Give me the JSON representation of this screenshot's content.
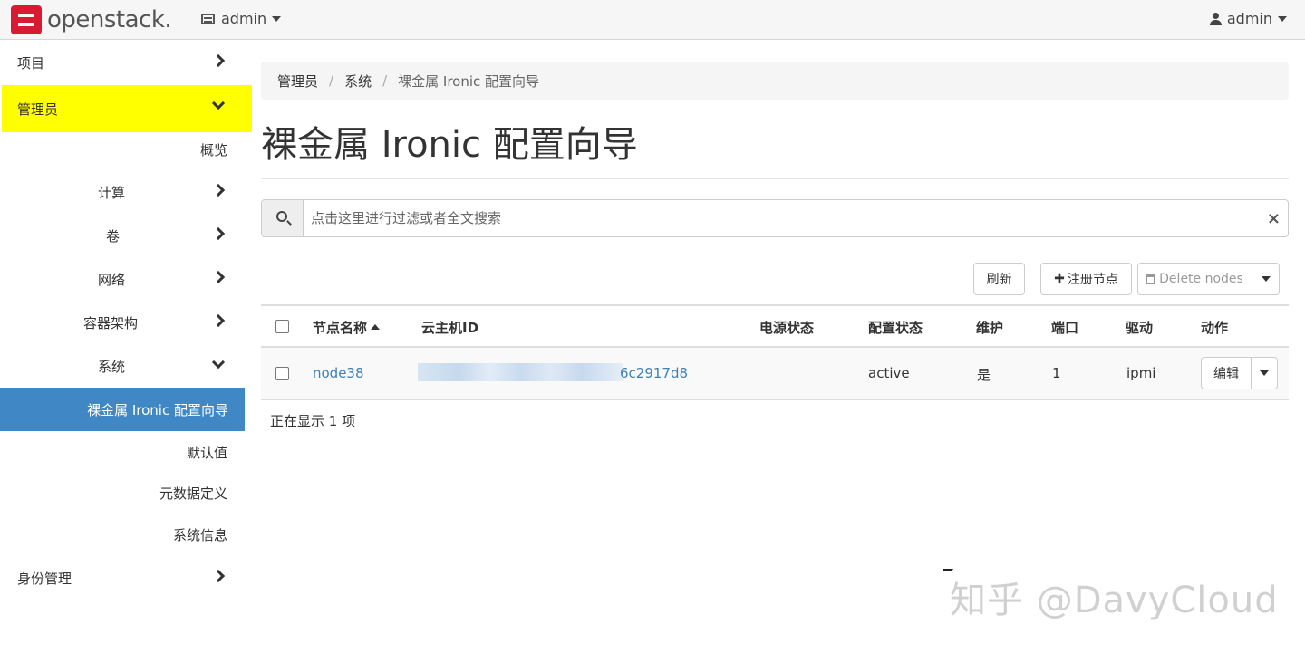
{
  "header": {
    "logo_text": "openstack.",
    "project": "admin",
    "user": "admin"
  },
  "sidebar": {
    "items": [
      {
        "label": "项目"
      },
      {
        "label": "管理员"
      },
      {
        "label": "概览"
      },
      {
        "label": "计算"
      },
      {
        "label": "卷"
      },
      {
        "label": "网络"
      },
      {
        "label": "容器架构"
      },
      {
        "label": "系统"
      },
      {
        "label": "裸金属 Ironic 配置向导"
      },
      {
        "label": "默认值"
      },
      {
        "label": "元数据定义"
      },
      {
        "label": "系统信息"
      },
      {
        "label": "身份管理"
      }
    ]
  },
  "breadcrumb": [
    "管理员",
    "系统",
    "裸金属 Ironic 配置向导"
  ],
  "page_title": "裸金属 Ironic 配置向导",
  "search": {
    "placeholder": "点击这里进行过滤或者全文搜索",
    "clear": "×"
  },
  "actions": {
    "refresh": "刷新",
    "register": "注册节点",
    "delete": "Delete nodes"
  },
  "table": {
    "columns": [
      "节点名称",
      "云主机ID",
      "电源状态",
      "配置状态",
      "维护",
      "端口",
      "驱动",
      "动作"
    ],
    "rows": [
      {
        "name": "node38",
        "instance_id_suffix": "6c2917d8",
        "power_state": "",
        "provision_state": "active",
        "maintenance": "是",
        "ports": "1",
        "driver": "ipmi",
        "action": "编辑"
      }
    ],
    "footer": "正在显示 1 项"
  },
  "watermark": "知乎 @DavyCloud"
}
